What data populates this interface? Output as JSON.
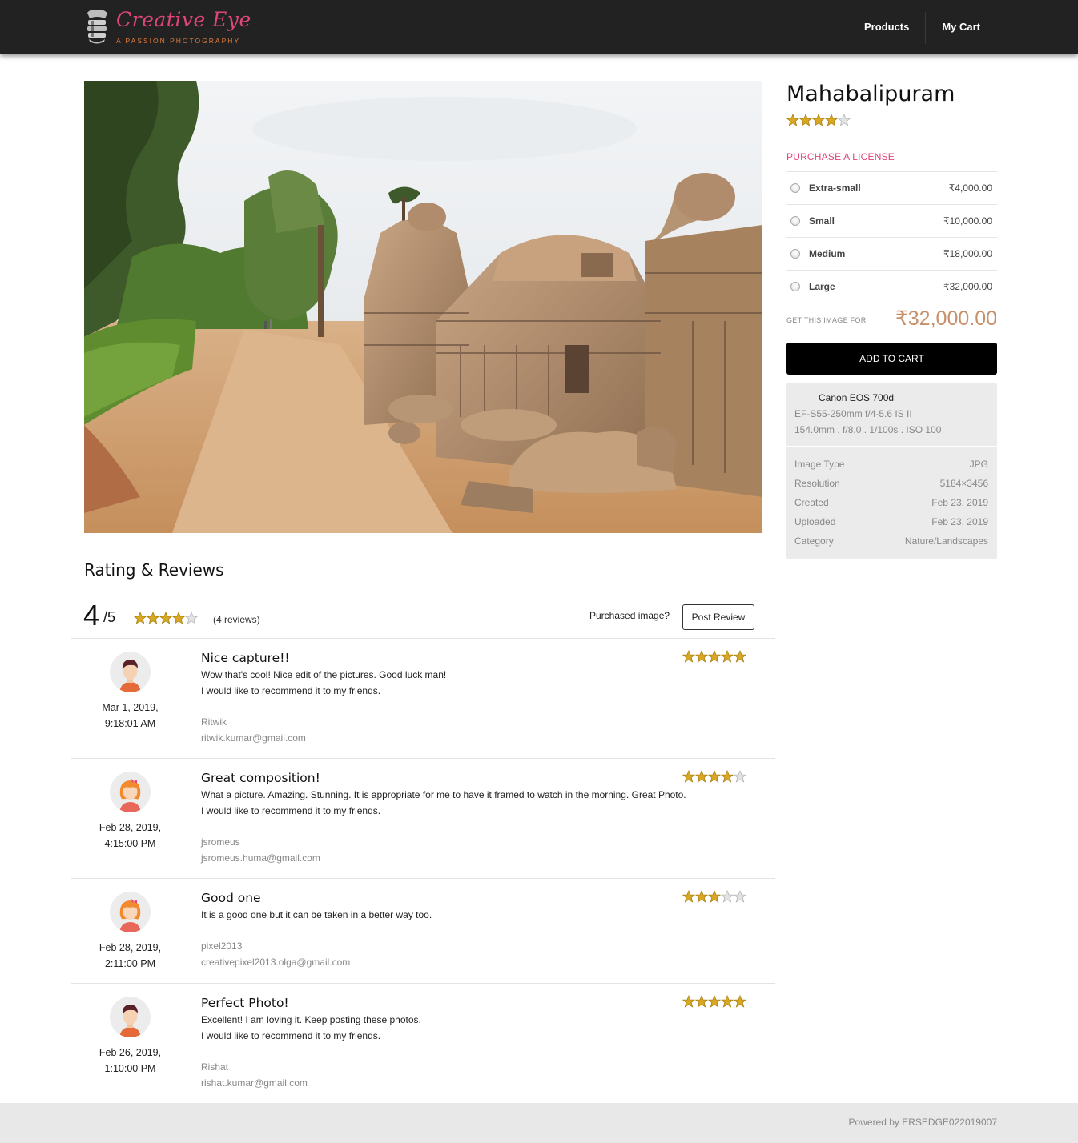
{
  "brand": {
    "name": "Creative Eye",
    "tagline": "A PASSION PHOTOGRAPHY"
  },
  "nav": {
    "products": "Products",
    "cart": "My Cart"
  },
  "product": {
    "title": "Mahabalipuram",
    "rating": 4,
    "purchase_heading": "PURCHASE A LICENSE",
    "licenses": [
      {
        "name": "Extra-small",
        "price": "₹4,000.00"
      },
      {
        "name": "Small",
        "price": "₹10,000.00"
      },
      {
        "name": "Medium",
        "price": "₹18,000.00"
      },
      {
        "name": "Large",
        "price": "₹32,000.00"
      }
    ],
    "get_label": "GET THIS IMAGE FOR",
    "get_price": "₹32,000.00",
    "add_to_cart": "ADD TO CART"
  },
  "camera": {
    "model": "Canon EOS 700d",
    "lens": "EF-S55-250mm f/4-5.6 IS II",
    "settings": "154.0mm .  f/8.0 .  1/100s .  ISO 100"
  },
  "meta": [
    {
      "key": "Image Type",
      "value": "JPG"
    },
    {
      "key": "Resolution",
      "value": "5184×3456"
    },
    {
      "key": "Created",
      "value": "Feb 23, 2019"
    },
    {
      "key": "Uploaded",
      "value": "Feb 23, 2019"
    },
    {
      "key": "Category",
      "value": "Nature/Landscapes"
    }
  ],
  "reviews_section": {
    "heading": "Rating & Reviews",
    "score": "4",
    "out_of": "/5",
    "summary_rating": 4,
    "count": "(4 reviews)",
    "purchased_label": "Purchased image?",
    "post_review": "Post Review"
  },
  "reviews": [
    {
      "title": "Nice capture!!",
      "body": [
        "Wow that's cool! Nice edit of the pictures. Good luck man!",
        "I would like to recommend it to my friends."
      ],
      "user": "Ritwik",
      "email": "ritwik.kumar@gmail.com",
      "date": "Mar 1, 2019,",
      "time": "9:18:01 AM",
      "rating": 5,
      "avatar": "male-avatar-icon"
    },
    {
      "title": "Great composition!",
      "body": [
        "What a picture. Amazing. Stunning. It is appropriate for me to have it framed to watch in the morning. Great Photo.",
        "I would like to recommend it to my friends."
      ],
      "user": "jsromeus",
      "email": "jsromeus.huma@gmail.com",
      "date": "Feb 28, 2019,",
      "time": "4:15:00 PM",
      "rating": 4,
      "avatar": "female-avatar-icon"
    },
    {
      "title": "Good one",
      "body": [
        "It is a good one but it can be taken in a better way too."
      ],
      "user": "pixel2013",
      "email": "creativepixel2013.olga@gmail.com",
      "date": "Feb 28, 2019,",
      "time": "2:11:00 PM",
      "rating": 3,
      "avatar": "female-avatar-icon"
    },
    {
      "title": "Perfect Photo!",
      "body": [
        "Excellent! I am loving it. Keep posting these photos.",
        "I would like to recommend it to my friends."
      ],
      "user": "Rishat",
      "email": "rishat.kumar@gmail.com",
      "date": "Feb 26, 2019,",
      "time": "1:10:00 PM",
      "rating": 5,
      "avatar": "male-avatar-icon"
    }
  ],
  "footer": {
    "text": "Powered by ERSEDGE022019007"
  },
  "colors": {
    "accent": "#e0457b",
    "price": "#c8906a",
    "header": "#222222",
    "star": "#d9a823"
  }
}
